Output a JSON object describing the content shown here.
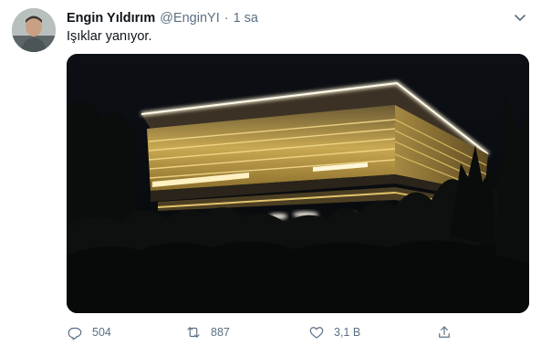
{
  "tweet": {
    "author_name": "Engin Yıldırım",
    "handle": "@EnginYI",
    "separator": "·",
    "time": "1 sa",
    "text": "Işıklar yanıyor.",
    "media_alt_icon": "photo",
    "actions": {
      "reply_count": "504",
      "retweet_count": "887",
      "like_count": "3,1 B"
    }
  },
  "colors": {
    "text_primary": "#0f1419",
    "text_secondary": "#5b7083",
    "media_background": "#050608",
    "building_light": "#f6e3a4"
  },
  "icons": [
    "more-caret-icon",
    "reply-icon",
    "retweet-icon",
    "like-icon",
    "share-icon"
  ]
}
